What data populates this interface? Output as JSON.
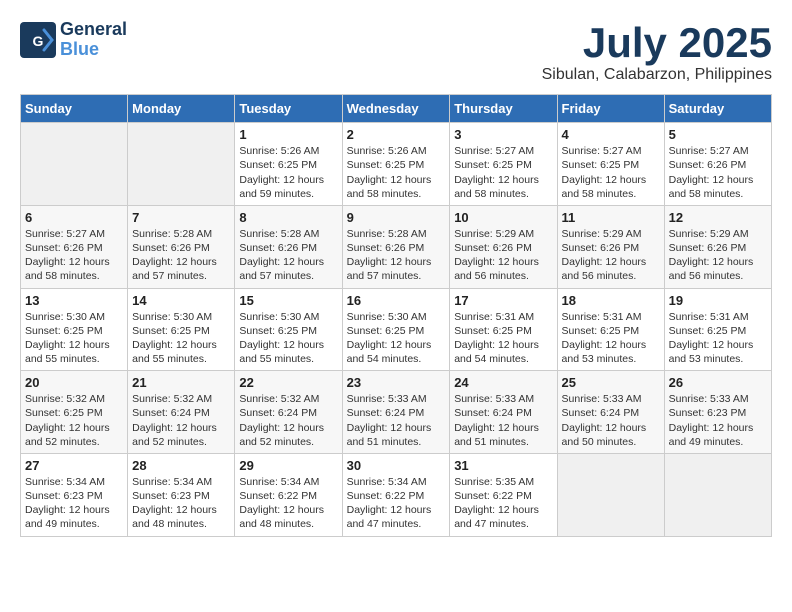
{
  "logo": {
    "line1": "General",
    "line2": "Blue"
  },
  "title": {
    "month": "July 2025",
    "location": "Sibulan, Calabarzon, Philippines"
  },
  "weekdays": [
    "Sunday",
    "Monday",
    "Tuesday",
    "Wednesday",
    "Thursday",
    "Friday",
    "Saturday"
  ],
  "weeks": [
    [
      {
        "day": "",
        "info": ""
      },
      {
        "day": "",
        "info": ""
      },
      {
        "day": "1",
        "info": "Sunrise: 5:26 AM\nSunset: 6:25 PM\nDaylight: 12 hours and 59 minutes."
      },
      {
        "day": "2",
        "info": "Sunrise: 5:26 AM\nSunset: 6:25 PM\nDaylight: 12 hours and 58 minutes."
      },
      {
        "day": "3",
        "info": "Sunrise: 5:27 AM\nSunset: 6:25 PM\nDaylight: 12 hours and 58 minutes."
      },
      {
        "day": "4",
        "info": "Sunrise: 5:27 AM\nSunset: 6:25 PM\nDaylight: 12 hours and 58 minutes."
      },
      {
        "day": "5",
        "info": "Sunrise: 5:27 AM\nSunset: 6:26 PM\nDaylight: 12 hours and 58 minutes."
      }
    ],
    [
      {
        "day": "6",
        "info": "Sunrise: 5:27 AM\nSunset: 6:26 PM\nDaylight: 12 hours and 58 minutes."
      },
      {
        "day": "7",
        "info": "Sunrise: 5:28 AM\nSunset: 6:26 PM\nDaylight: 12 hours and 57 minutes."
      },
      {
        "day": "8",
        "info": "Sunrise: 5:28 AM\nSunset: 6:26 PM\nDaylight: 12 hours and 57 minutes."
      },
      {
        "day": "9",
        "info": "Sunrise: 5:28 AM\nSunset: 6:26 PM\nDaylight: 12 hours and 57 minutes."
      },
      {
        "day": "10",
        "info": "Sunrise: 5:29 AM\nSunset: 6:26 PM\nDaylight: 12 hours and 56 minutes."
      },
      {
        "day": "11",
        "info": "Sunrise: 5:29 AM\nSunset: 6:26 PM\nDaylight: 12 hours and 56 minutes."
      },
      {
        "day": "12",
        "info": "Sunrise: 5:29 AM\nSunset: 6:26 PM\nDaylight: 12 hours and 56 minutes."
      }
    ],
    [
      {
        "day": "13",
        "info": "Sunrise: 5:30 AM\nSunset: 6:25 PM\nDaylight: 12 hours and 55 minutes."
      },
      {
        "day": "14",
        "info": "Sunrise: 5:30 AM\nSunset: 6:25 PM\nDaylight: 12 hours and 55 minutes."
      },
      {
        "day": "15",
        "info": "Sunrise: 5:30 AM\nSunset: 6:25 PM\nDaylight: 12 hours and 55 minutes."
      },
      {
        "day": "16",
        "info": "Sunrise: 5:30 AM\nSunset: 6:25 PM\nDaylight: 12 hours and 54 minutes."
      },
      {
        "day": "17",
        "info": "Sunrise: 5:31 AM\nSunset: 6:25 PM\nDaylight: 12 hours and 54 minutes."
      },
      {
        "day": "18",
        "info": "Sunrise: 5:31 AM\nSunset: 6:25 PM\nDaylight: 12 hours and 53 minutes."
      },
      {
        "day": "19",
        "info": "Sunrise: 5:31 AM\nSunset: 6:25 PM\nDaylight: 12 hours and 53 minutes."
      }
    ],
    [
      {
        "day": "20",
        "info": "Sunrise: 5:32 AM\nSunset: 6:25 PM\nDaylight: 12 hours and 52 minutes."
      },
      {
        "day": "21",
        "info": "Sunrise: 5:32 AM\nSunset: 6:24 PM\nDaylight: 12 hours and 52 minutes."
      },
      {
        "day": "22",
        "info": "Sunrise: 5:32 AM\nSunset: 6:24 PM\nDaylight: 12 hours and 52 minutes."
      },
      {
        "day": "23",
        "info": "Sunrise: 5:33 AM\nSunset: 6:24 PM\nDaylight: 12 hours and 51 minutes."
      },
      {
        "day": "24",
        "info": "Sunrise: 5:33 AM\nSunset: 6:24 PM\nDaylight: 12 hours and 51 minutes."
      },
      {
        "day": "25",
        "info": "Sunrise: 5:33 AM\nSunset: 6:24 PM\nDaylight: 12 hours and 50 minutes."
      },
      {
        "day": "26",
        "info": "Sunrise: 5:33 AM\nSunset: 6:23 PM\nDaylight: 12 hours and 49 minutes."
      }
    ],
    [
      {
        "day": "27",
        "info": "Sunrise: 5:34 AM\nSunset: 6:23 PM\nDaylight: 12 hours and 49 minutes."
      },
      {
        "day": "28",
        "info": "Sunrise: 5:34 AM\nSunset: 6:23 PM\nDaylight: 12 hours and 48 minutes."
      },
      {
        "day": "29",
        "info": "Sunrise: 5:34 AM\nSunset: 6:22 PM\nDaylight: 12 hours and 48 minutes."
      },
      {
        "day": "30",
        "info": "Sunrise: 5:34 AM\nSunset: 6:22 PM\nDaylight: 12 hours and 47 minutes."
      },
      {
        "day": "31",
        "info": "Sunrise: 5:35 AM\nSunset: 6:22 PM\nDaylight: 12 hours and 47 minutes."
      },
      {
        "day": "",
        "info": ""
      },
      {
        "day": "",
        "info": ""
      }
    ]
  ]
}
